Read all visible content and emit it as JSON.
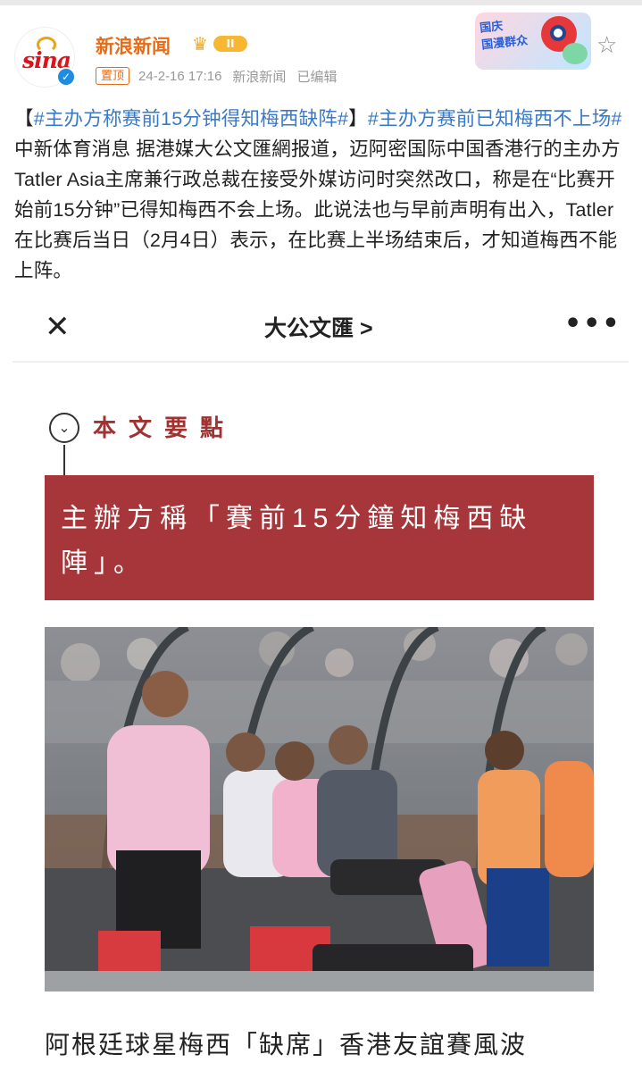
{
  "post": {
    "account_name": "新浪新闻",
    "account_level_badge": "II",
    "pin_label": "置顶",
    "timestamp": "24-2-16 17:16",
    "source": "新浪新闻",
    "edited": "已编辑",
    "avatar_logo": "sina",
    "sticker_text": "国庆\n国漫群众",
    "hashtag1": "#主办方称赛前15分钟得知梅西缺阵#",
    "hashtag2": "#主办方赛前已知梅西不上场#",
    "bracket_open": "【",
    "bracket_close": "】",
    "body": "中新体育消息 据港媒大公文匯網报道，迈阿密国际中国香港行的主办方Tatler Asia主席兼行政总裁在接受外媒访问时突然改口，称是在“比赛开始前15分钟”已得知梅西不会上场。此说法也与早前声明有出入，Tatler在比赛后当日（2月4日）表示，在比赛上半场结束后，才知道梅西不能上阵。"
  },
  "article": {
    "close_icon": "×",
    "source_title": "大公文匯 >",
    "more_icon": "•••",
    "key_points_label": "本文要點",
    "key_point_text": "主辦方稱「賽前15分鐘知梅西缺陣」。",
    "headline": "阿根廷球星梅西「缺席」香港友誼賽風波"
  },
  "colors": {
    "accent_orange": "#e86b16",
    "hashtag_blue": "#3b79c5",
    "highlight_red": "#a7363a"
  }
}
